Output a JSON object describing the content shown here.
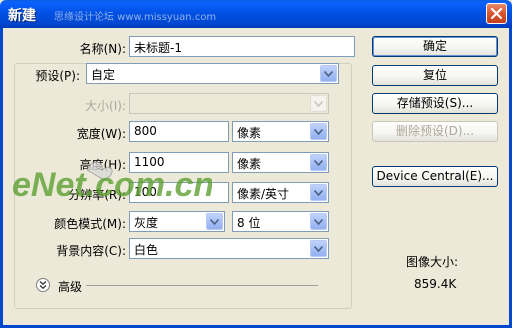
{
  "window": {
    "title": "新建",
    "title_watermark": "思缘设计论坛 www.missyuan.com"
  },
  "form": {
    "name_label": "名称(N):",
    "name_value": "未标题-1",
    "preset_label": "预设(P):",
    "preset_value": "自定",
    "size_label": "大小(I):",
    "size_value": "",
    "width_label": "宽度(W):",
    "width_value": "800",
    "width_unit": "像素",
    "height_label": "高度(H):",
    "height_value": "1100",
    "height_unit": "像素",
    "resolution_label": "分辨率(R):",
    "resolution_value": "100",
    "resolution_unit": "像素/英寸",
    "color_mode_label": "颜色模式(M):",
    "color_mode_value": "灰度",
    "bit_depth_value": "8 位",
    "background_label": "背景内容(C):",
    "background_value": "白色",
    "advanced_label": "高级"
  },
  "buttons": {
    "ok": "确定",
    "reset": "复位",
    "save_preset": "存储预设(S)...",
    "delete_preset": "删除预设(D)...",
    "device_central": "Device Central(E)..."
  },
  "info": {
    "image_size_label": "图像大小:",
    "image_size_value": "859.4K"
  },
  "watermark": {
    "text": "eNet.com.cn"
  }
}
